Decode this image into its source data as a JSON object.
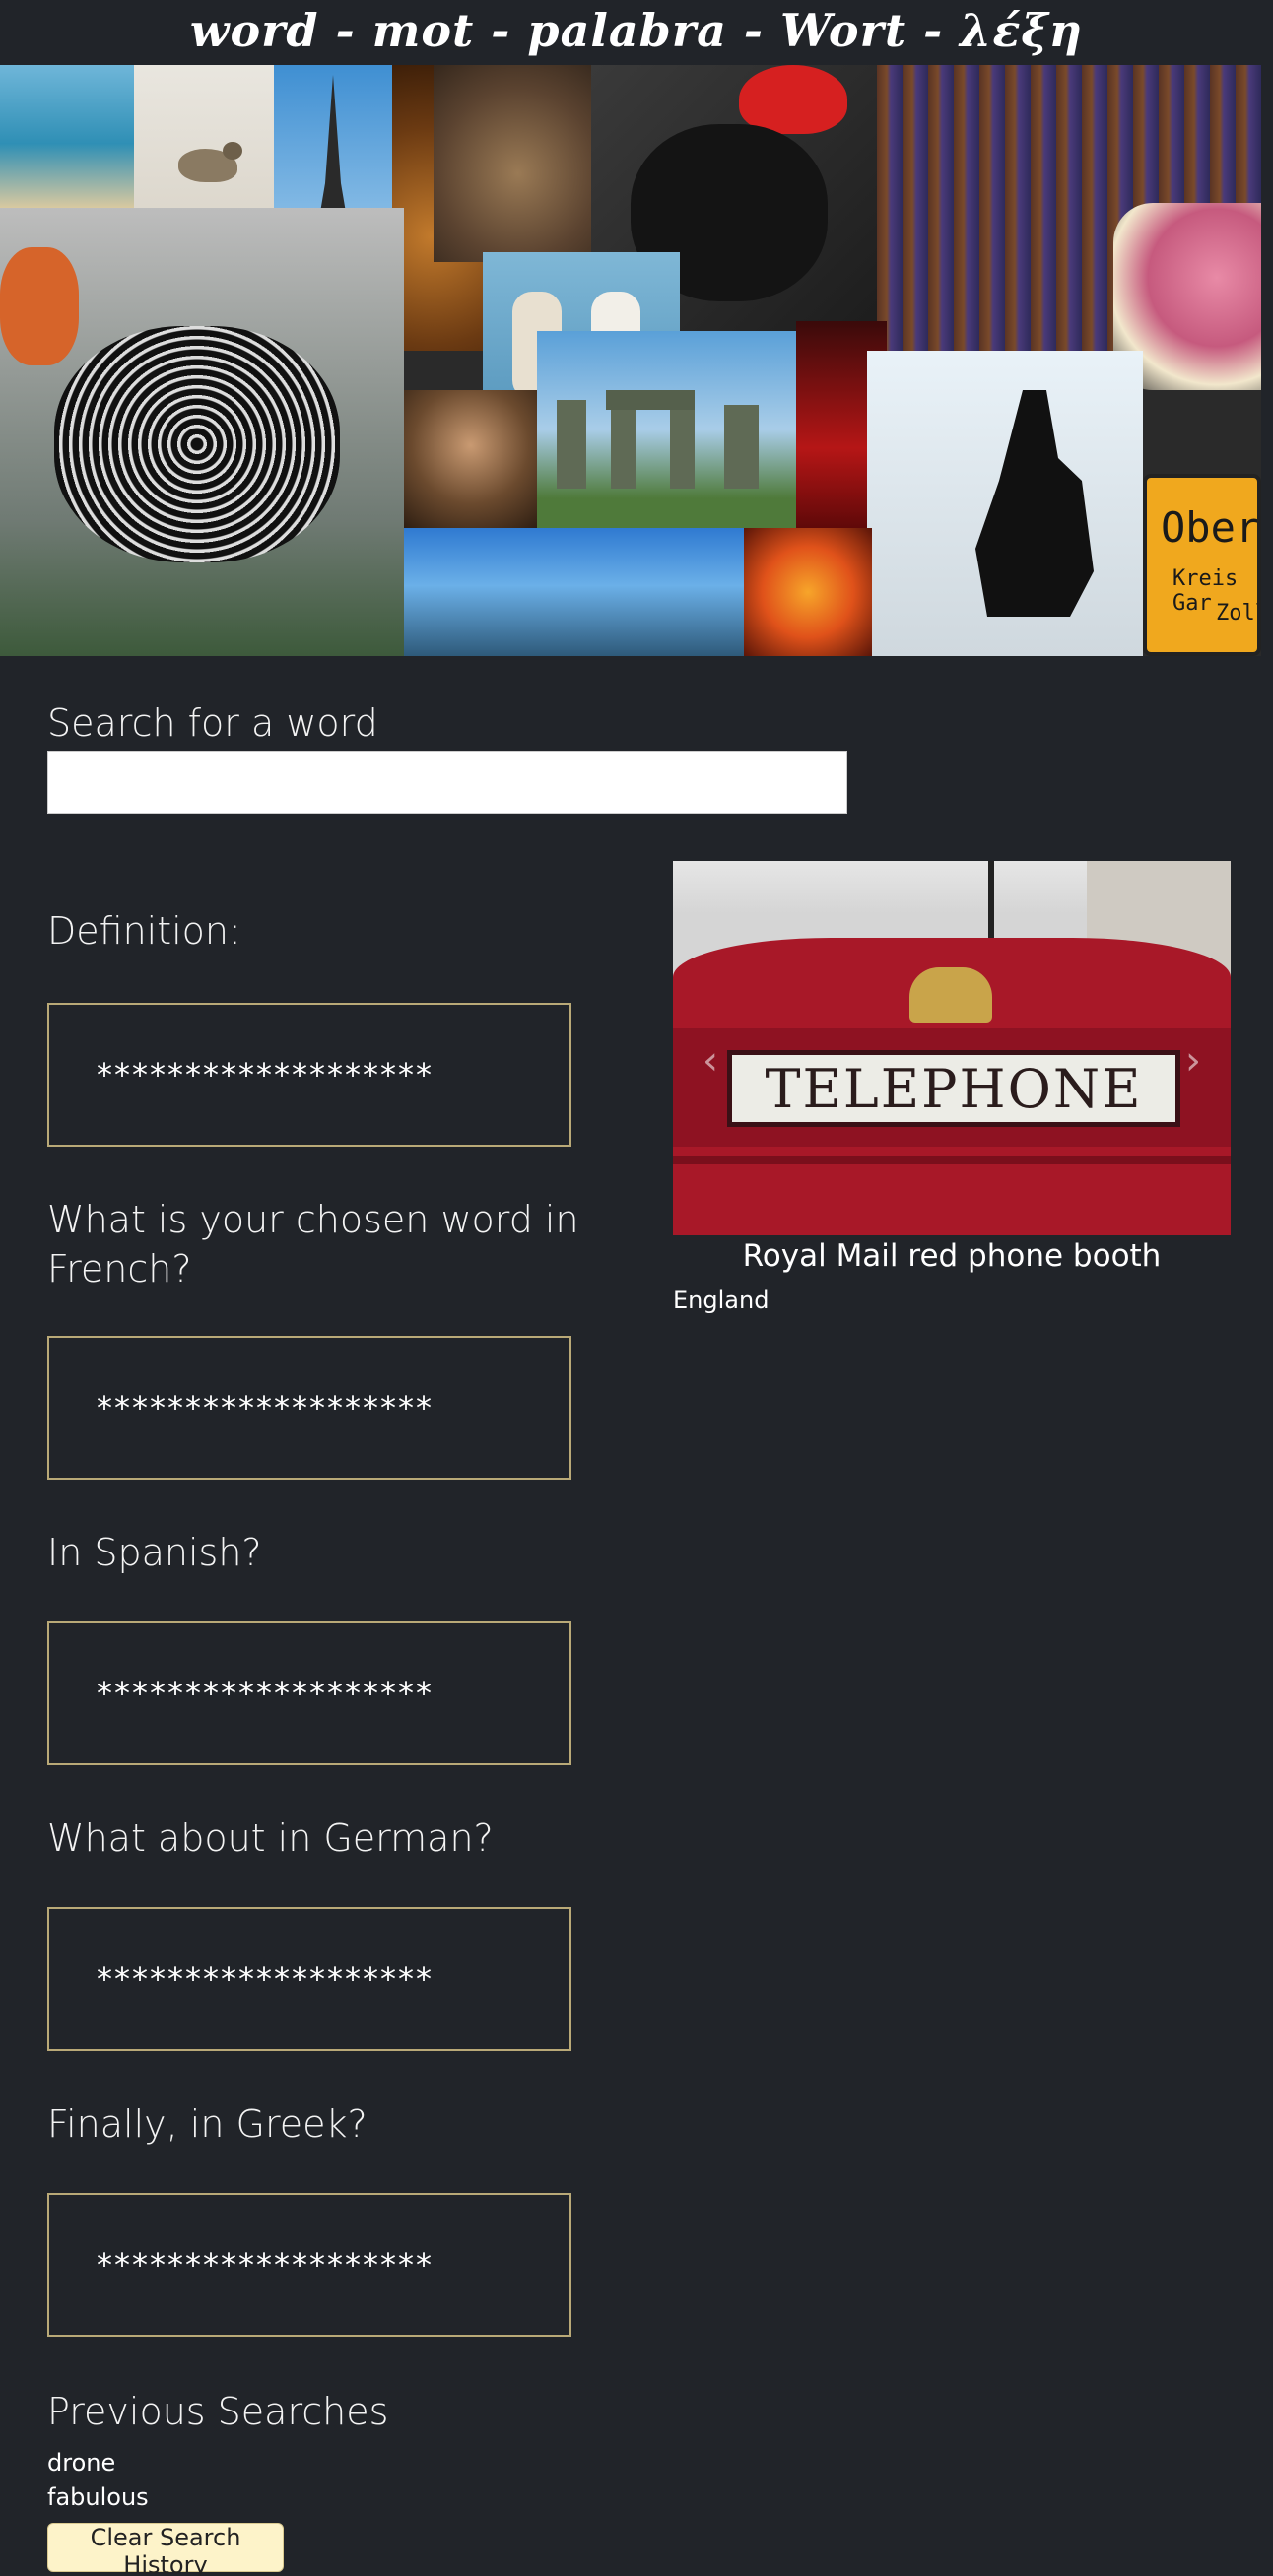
{
  "header": {
    "title": "word - mot - palabra - Wort - λέξη"
  },
  "banner": {
    "sign_text_1": "Obera",
    "sign_text_2": "Kreis Gar",
    "sign_text_3": "Zollg"
  },
  "search": {
    "label": "Search for a word",
    "value": ""
  },
  "questions": [
    {
      "label": "Definition:",
      "answer": "*******************"
    },
    {
      "label": "What is your chosen word in French?",
      "answer": "*******************"
    },
    {
      "label": "In Spanish?",
      "answer": "*******************"
    },
    {
      "label": "What about in German?",
      "answer": "*******************"
    },
    {
      "label": "Finally, in Greek?",
      "answer": "*******************"
    }
  ],
  "carousel": {
    "sign_text": "TELEPHONE",
    "caption": "Royal Mail red phone booth",
    "subcaption": "England",
    "prev_icon": "chevron-left-icon",
    "next_icon": "chevron-right-icon"
  },
  "history": {
    "title": "Previous Searches",
    "items": [
      "drone",
      "fabulous"
    ],
    "clear_label": "Clear Search History"
  },
  "colors": {
    "background": "#212429",
    "answer_border": "#b9a977",
    "button_bg": "#fdf3c9",
    "booth_red": "#a81828"
  }
}
